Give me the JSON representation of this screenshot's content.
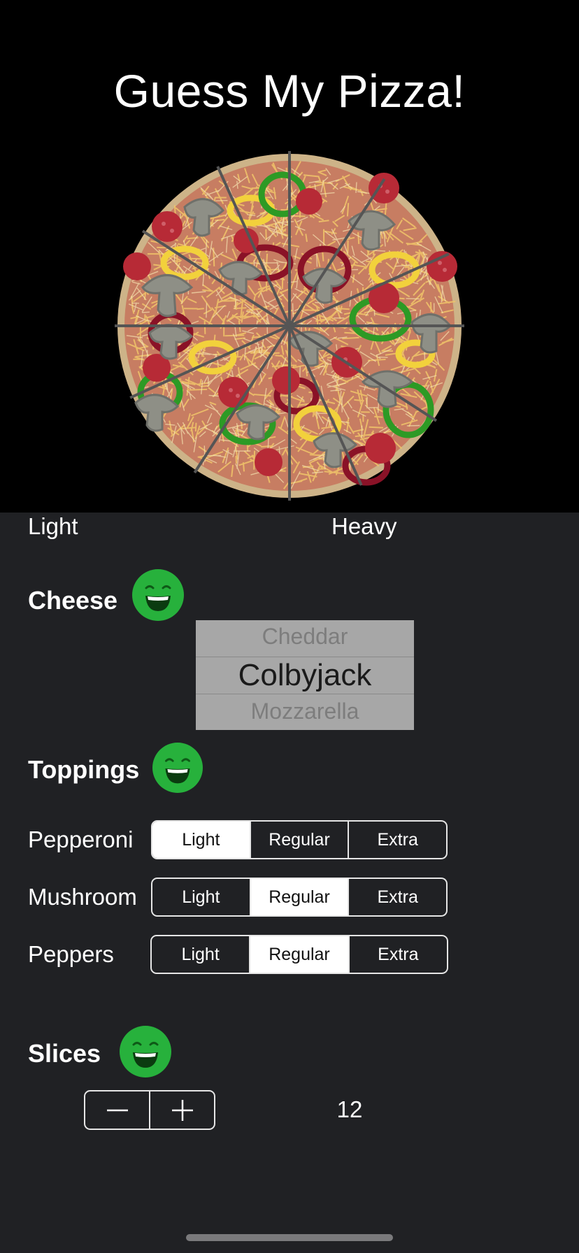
{
  "title": "Guess My Pizza!",
  "slider_labels": {
    "min": "Light",
    "max": "Heavy"
  },
  "cheese": {
    "heading": "Cheese",
    "picker": {
      "previous": "Cheddar",
      "selected": "Colbyjack",
      "next": "Mozzarella"
    }
  },
  "toppings": {
    "heading": "Toppings",
    "options": [
      "Light",
      "Regular",
      "Extra"
    ],
    "items": [
      {
        "label": "Pepperoni",
        "selected": "Light"
      },
      {
        "label": "Mushroom",
        "selected": "Regular"
      },
      {
        "label": "Peppers",
        "selected": "Regular"
      }
    ]
  },
  "slices": {
    "heading": "Slices",
    "count": "12"
  },
  "status_icon": "happy-face-icon",
  "colors": {
    "status_green": "#27b13c",
    "top_bg": "#000000",
    "page_bg": "#202124",
    "picker_bg": "#a7a7a7"
  }
}
